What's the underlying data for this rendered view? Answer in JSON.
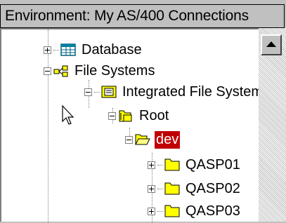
{
  "header": {
    "title": "Environment: My AS/400 Connections"
  },
  "tree": {
    "items": [
      {
        "label": "Database",
        "icon": "database-icon",
        "expander": "plus"
      },
      {
        "label": "File Systems",
        "icon": "file-systems-icon",
        "expander": "minus"
      },
      {
        "label": "Integrated File System",
        "icon": "integrated-file-system-icon",
        "expander": "minus"
      },
      {
        "label": "Root",
        "icon": "root-folder-icon",
        "expander": "minus"
      },
      {
        "label": "dev",
        "icon": "open-folder-icon",
        "expander": "minus",
        "selected": true
      },
      {
        "label": "QASP01",
        "icon": "folder-icon",
        "expander": "plus"
      },
      {
        "label": "QASP02",
        "icon": "folder-icon",
        "expander": "plus"
      },
      {
        "label": "QASP03",
        "icon": "folder-icon",
        "expander": "plus"
      }
    ]
  },
  "colors": {
    "selection": "#c00000",
    "folder": "#ffff00",
    "window": "#c0c0c0"
  }
}
